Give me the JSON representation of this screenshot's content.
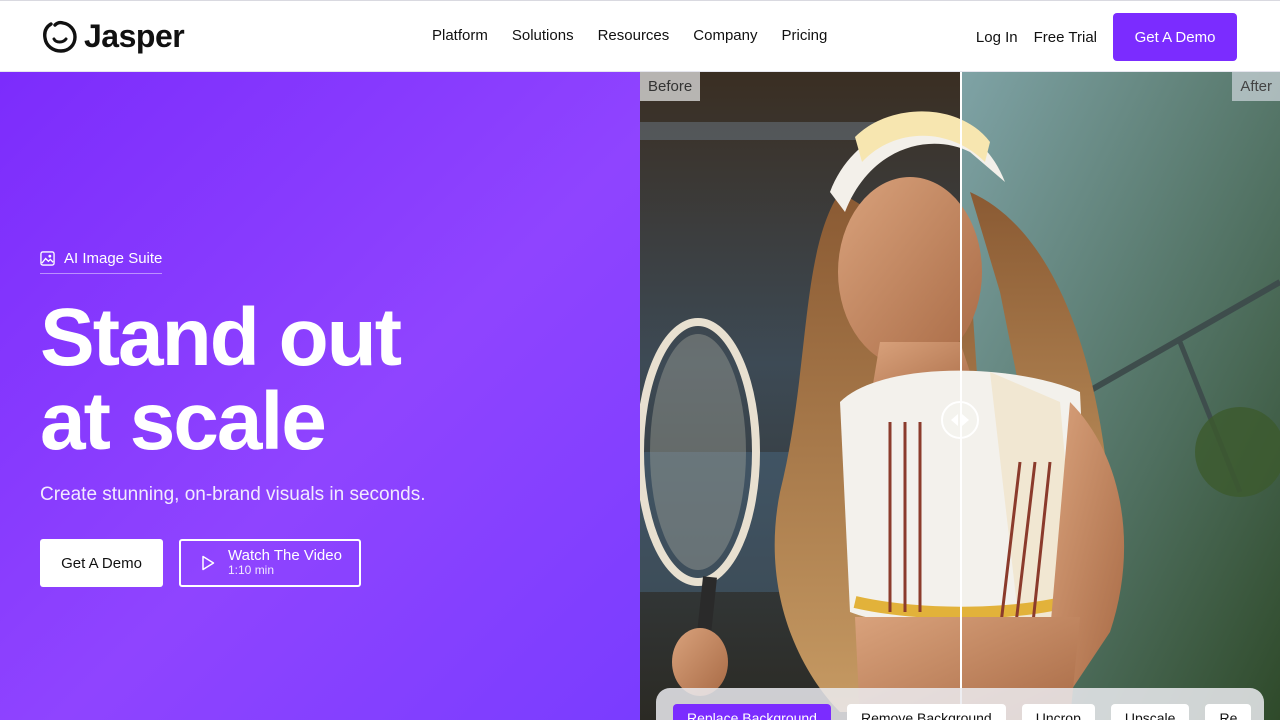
{
  "header": {
    "brand": "Jasper",
    "nav": [
      {
        "label": "Platform"
      },
      {
        "label": "Solutions"
      },
      {
        "label": "Resources"
      },
      {
        "label": "Company"
      },
      {
        "label": "Pricing"
      }
    ],
    "login_label": "Log In",
    "trial_label": "Free Trial",
    "demo_label": "Get A Demo"
  },
  "hero": {
    "tag": "AI Image Suite",
    "headline_line1": "Stand out",
    "headline_line2": "at scale",
    "subheadline": "Create stunning, on-brand visuals in seconds.",
    "cta_primary": "Get A Demo",
    "cta_video_title": "Watch The Video",
    "cta_video_length": "1:10 min"
  },
  "compare": {
    "before_label": "Before",
    "after_label": "After",
    "tools": [
      {
        "label": "Replace Background",
        "active": true
      },
      {
        "label": "Remove Background",
        "active": false
      },
      {
        "label": "Uncrop",
        "active": false
      },
      {
        "label": "Upscale",
        "active": false
      },
      {
        "label": "Re",
        "active": false
      }
    ]
  },
  "colors": {
    "brand_purple": "#7b2cff",
    "white": "#ffffff"
  }
}
